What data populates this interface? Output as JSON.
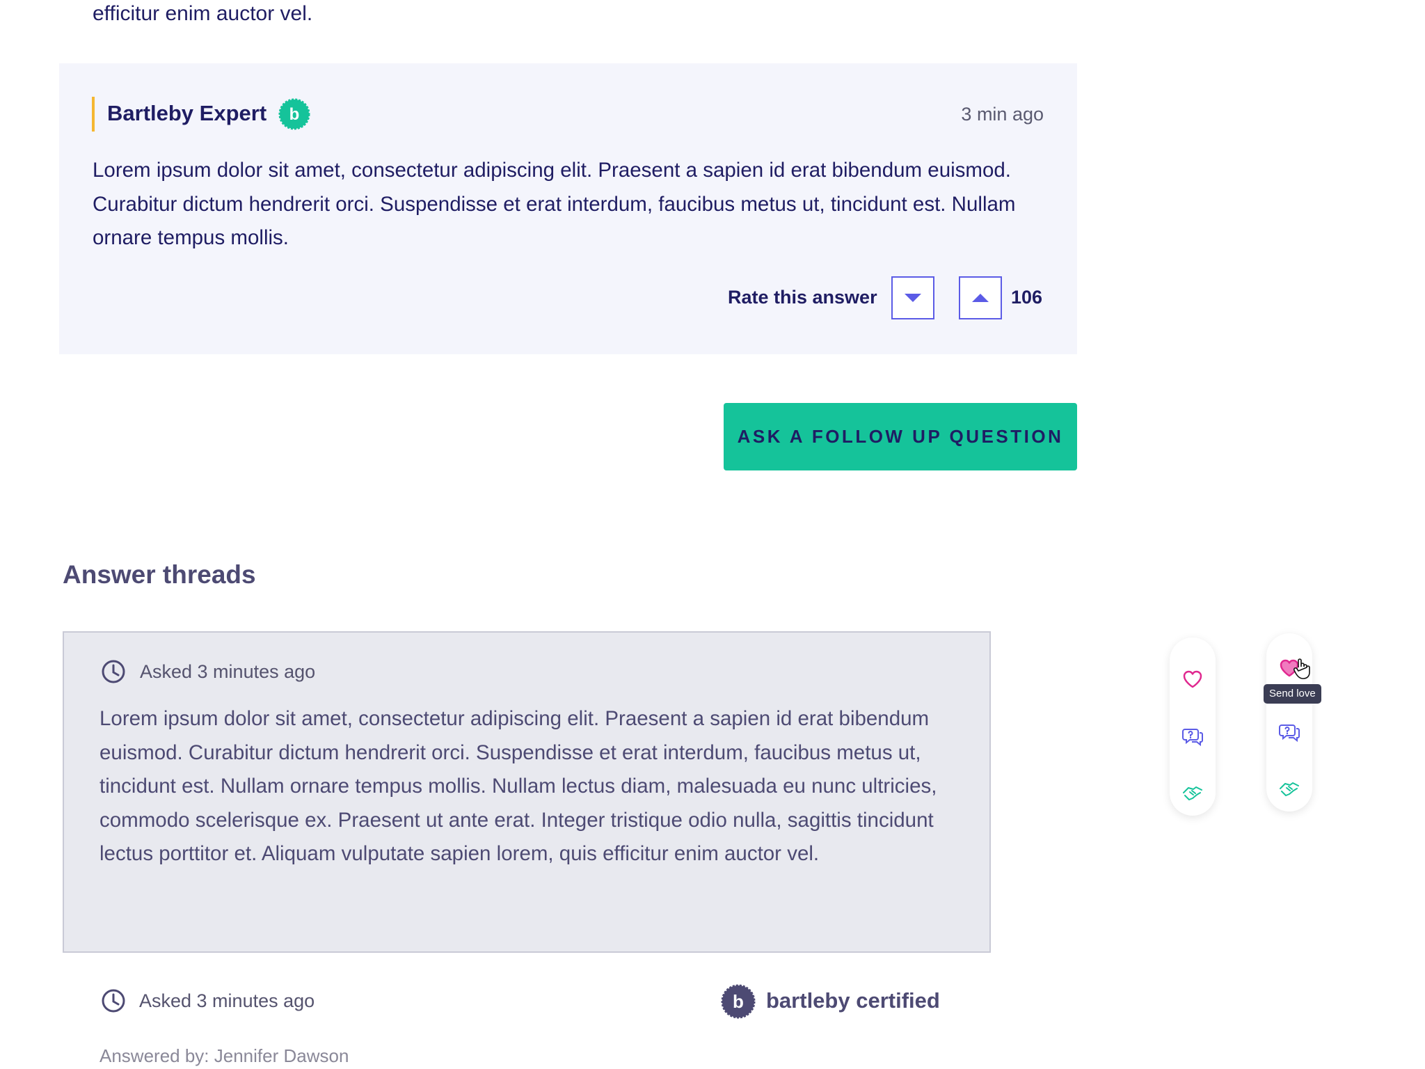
{
  "previous_text": "efficitur enim auctor vel.",
  "expert_answer": {
    "author": "Bartleby Expert",
    "badge_letter": "b",
    "time": "3 min ago",
    "body": "Lorem ipsum dolor sit amet, consectetur adipiscing elit. Praesent a sapien id erat bibendum euismod. Curabitur dictum hendrerit orci. Suspendisse et erat interdum, faucibus metus ut, tincidunt est. Nullam ornare tempus mollis.",
    "rate_label": "Rate this answer",
    "vote_count": "106"
  },
  "follow_up_button": "ASK A FOLLOW UP QUESTION",
  "threads": {
    "title": "Answer threads",
    "thread": {
      "asked": "Asked 3 minutes ago",
      "body": "Lorem ipsum dolor sit amet, consectetur adipiscing elit. Praesent a sapien id erat bibendum euismod. Curabitur dictum hendrerit orci. Suspendisse et erat interdum, faucibus metus ut, tincidunt est. Nullam ornare tempus mollis. Nullam lectus diam, malesuada eu nunc ultricies, commodo scelerisque ex. Praesent ut ante erat. Integer tristique odio nulla, sagittis tincidunt lectus porttitor et. Aliquam vulputate sapien lorem, quis efficitur enim auctor vel."
    },
    "footer": {
      "asked": "Asked 3 minutes ago",
      "certified_letter": "b",
      "certified_label": "bartleby certified",
      "answered_by": "Answered by: Jennifer Dawson"
    }
  },
  "action_rails": [
    {
      "icons": [
        "heart-outline-icon",
        "question-chat-icon",
        "handshake-icon"
      ]
    },
    {
      "icons": [
        "heart-filled-icon",
        "question-chat-icon",
        "handshake-icon"
      ],
      "tooltip": "Send love"
    }
  ],
  "colors": {
    "accent_green": "#15c39a",
    "accent_blue": "#5b5be6",
    "navy_text": "#1f1d63",
    "heart_pink": "#e0288f",
    "expert_bar": "#f5b731"
  }
}
